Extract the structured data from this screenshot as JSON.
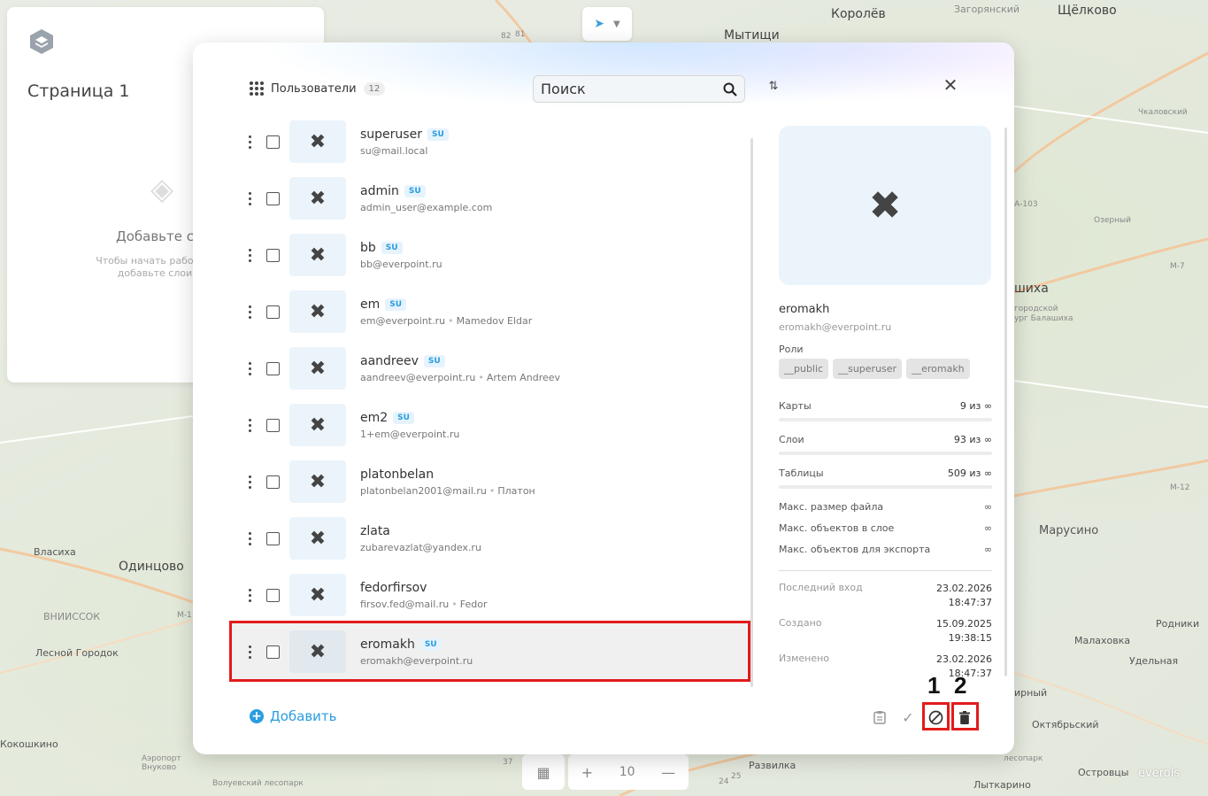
{
  "map": {
    "labels": [
      "Королёв",
      "Загорянский",
      "Щёлково",
      "Мытищи",
      "Чкаловский",
      "Озерный",
      "шиха",
      "городской",
      "ург Балашиха",
      "Марусино",
      "Власиха",
      "Одинцово",
      "ВНИИССОК",
      "Лесной Городок",
      "Кокошкино",
      "Аэропорт Внуково",
      "Волуевский лесопарк",
      "Развилка",
      "Лыткарино",
      "Островцы",
      "Малаховка",
      "Родники",
      "Удельная",
      "ирный",
      "Октябрьский",
      "лесопарк"
    ],
    "road_labels": [
      "А-103",
      "М-7",
      "М-12",
      "М-1",
      "82",
      "81",
      "37",
      "24",
      "25"
    ]
  },
  "page_panel": {
    "title": "Страница 1",
    "empty_title": "Добавьте сл",
    "empty_text_1": "Чтобы начать работу с п",
    "empty_text_2": "добавьте слои в"
  },
  "zoom": {
    "plus": "+",
    "level": "10",
    "minus": "—"
  },
  "brand": "everois",
  "modal": {
    "title": "Пользователи",
    "count": "12",
    "search_placeholder": "Поиск",
    "add_label": "Добавить",
    "users": [
      {
        "name": "superuser",
        "su": "SU",
        "email": "su@mail.local",
        "full": ""
      },
      {
        "name": "admin",
        "su": "SU",
        "email": "admin_user@example.com",
        "full": ""
      },
      {
        "name": "bb",
        "su": "SU",
        "email": "bb@everpoint.ru",
        "full": ""
      },
      {
        "name": "em",
        "su": "SU",
        "email": "em@everpoint.ru",
        "full": "Mamedov Eldar"
      },
      {
        "name": "aandreev",
        "su": "SU",
        "email": "aandreev@everpoint.ru",
        "full": "Artem Andreev"
      },
      {
        "name": "em2",
        "su": "SU",
        "email": "1+em@everpoint.ru",
        "full": ""
      },
      {
        "name": "platonbelan",
        "su": "",
        "email": "platonbelan2001@mail.ru",
        "full": "Платон"
      },
      {
        "name": "zlata",
        "su": "",
        "email": "zubarevazlat@yandex.ru",
        "full": ""
      },
      {
        "name": "fedorfirsov",
        "su": "",
        "email": "firsov.fed@mail.ru",
        "full": "Fedor"
      },
      {
        "name": "eromakh",
        "su": "SU",
        "email": "eromakh@everpoint.ru",
        "full": ""
      }
    ],
    "selected_index": 9,
    "detail": {
      "name": "eromakh",
      "email": "eromakh@everpoint.ru",
      "roles_label": "Роли",
      "roles": [
        "__public",
        "__superuser",
        "__eromakh"
      ],
      "quotas": [
        {
          "label": "Карты",
          "value": "9 из ∞"
        },
        {
          "label": "Слои",
          "value": "93 из ∞"
        },
        {
          "label": "Таблицы",
          "value": "509 из ∞"
        }
      ],
      "limits": [
        {
          "label": "Макс. размер файла",
          "value": "∞"
        },
        {
          "label": "Макс. объектов в слое",
          "value": "∞"
        },
        {
          "label": "Макс. объектов для экспорта",
          "value": "∞"
        }
      ],
      "dates": [
        {
          "label": "Последний вход",
          "date": "23.02.2026",
          "time": "18:47:37"
        },
        {
          "label": "Создано",
          "date": "15.09.2025",
          "time": "19:38:15"
        },
        {
          "label": "Изменено",
          "date": "23.02.2026",
          "time": "18:47:37"
        }
      ]
    },
    "annotations": {
      "one": "1",
      "two": "2"
    }
  },
  "colors": {
    "accent": "#2a9de0",
    "highlight": "#e21b1b"
  }
}
